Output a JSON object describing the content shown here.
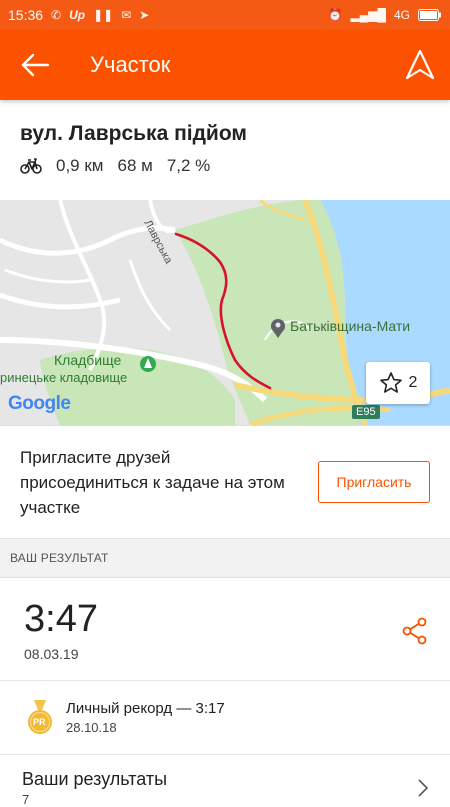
{
  "status_bar": {
    "time": "15:36",
    "notification_icons": [
      "viber-icon",
      "up-icon",
      "pause-icon",
      "mail-icon",
      "telegram-icon"
    ],
    "network": "4G",
    "right_icons": [
      "alarm-icon",
      "signal-icon",
      "battery-icon"
    ]
  },
  "appbar": {
    "title": "Участок",
    "back_icon": "arrow-left-icon",
    "nav_icon": "navigation-arrow-icon",
    "bg_color": "#fc5200"
  },
  "segment": {
    "name": "вул. Лаврська підйом",
    "activity_icon": "bicycle-icon",
    "distance": "0,9 км",
    "elevation": "68 м",
    "grade": "7,2 %"
  },
  "map": {
    "labels": {
      "street": "Лаврська",
      "landmark": "Батьківщина-Мати",
      "cemetery": "Кладбище",
      "cemetery_sub": "ринецьке кладовище",
      "route_badge": "E95",
      "google": "Google"
    },
    "star_count": "2"
  },
  "invite": {
    "text": "Пригласите друзей присоединиться к задаче на этом участке",
    "button": "Пригласить"
  },
  "results": {
    "section_label": "ВАШ РЕЗУЛЬТАТ",
    "time": "3:47",
    "date": "08.03.19",
    "share_icon": "share-icon",
    "pr_badge": "PR",
    "pr_title": "Личный рекорд — 3:17",
    "pr_date": "28.10.18",
    "all_title": "Ваши результаты",
    "all_count": "7"
  }
}
